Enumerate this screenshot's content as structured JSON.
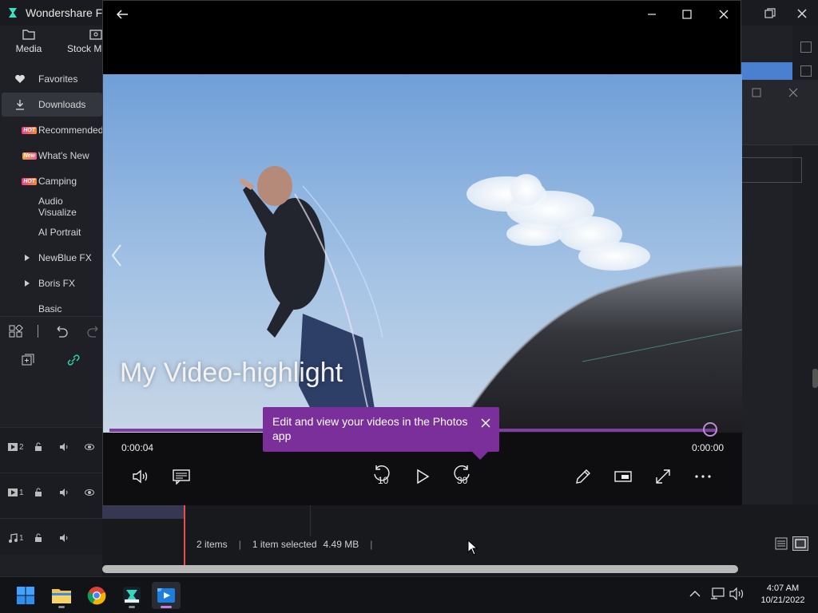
{
  "filmora": {
    "title": "Wondershare Film",
    "tabs": [
      {
        "label": "Media",
        "icon": "folder-icon"
      },
      {
        "label": "Stock M",
        "icon": "stock-media-icon"
      }
    ],
    "sidebar": [
      {
        "label": "Favorites",
        "icon": "heart-icon",
        "badge": ""
      },
      {
        "label": "Downloads",
        "icon": "download-icon",
        "badge": ""
      },
      {
        "label": "Recommended",
        "icon": "",
        "badge": "HOT"
      },
      {
        "label": "What's New",
        "icon": "",
        "badge": "New"
      },
      {
        "label": "Camping",
        "icon": "",
        "badge": "HOT"
      },
      {
        "label": "Audio Visualize",
        "icon": "",
        "badge": ""
      },
      {
        "label": "AI Portrait",
        "icon": "",
        "badge": ""
      },
      {
        "label": "NewBlue FX",
        "icon": "expand-arrow-icon",
        "badge": ""
      },
      {
        "label": "Boris FX",
        "icon": "expand-arrow-icon",
        "badge": ""
      },
      {
        "label": "Basic",
        "icon": "",
        "badge": ""
      }
    ],
    "tracks": [
      {
        "num": "2",
        "type": "video"
      },
      {
        "num": "1",
        "type": "video"
      },
      {
        "num": "1",
        "type": "audio"
      }
    ],
    "status": {
      "items": "2 items",
      "selected": "1 item selected",
      "size": "4.49 MB"
    }
  },
  "photos": {
    "video_title": "My Video-highlight",
    "time_current": "0:00:04",
    "time_total": "0:00:00",
    "progress": 0.99,
    "skip_back": "10",
    "skip_forward": "30",
    "tooltip": "Edit and view your videos in the Photos app",
    "accent": "#7a2f9a"
  },
  "taskbar": {
    "apps": [
      "start-icon",
      "file-explorer-icon",
      "chrome-icon",
      "filmora-icon",
      "photos-icon"
    ],
    "time": "4:07 AM",
    "date": "10/21/2022"
  }
}
